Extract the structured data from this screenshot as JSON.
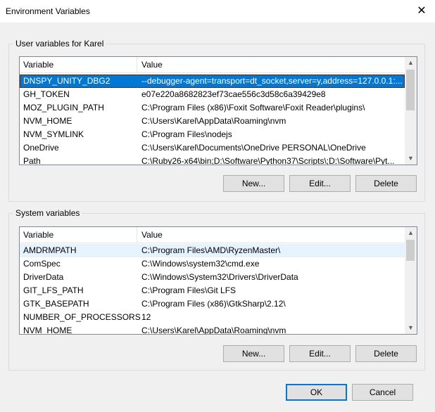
{
  "window": {
    "title": "Environment Variables",
    "close_glyph": "✕"
  },
  "user_section": {
    "label": "User variables for Karel",
    "columns": [
      "Variable",
      "Value"
    ],
    "rows": [
      {
        "variable": "DNSPY_UNITY_DBG2",
        "value": "--debugger-agent=transport=dt_socket,server=y,address=127.0.0.1:..."
      },
      {
        "variable": "GH_TOKEN",
        "value": "e07e220a8682823ef73cae556c3d58c6a39429e8"
      },
      {
        "variable": "MOZ_PLUGIN_PATH",
        "value": "C:\\Program Files (x86)\\Foxit Software\\Foxit Reader\\plugins\\"
      },
      {
        "variable": "NVM_HOME",
        "value": "C:\\Users\\Karel\\AppData\\Roaming\\nvm"
      },
      {
        "variable": "NVM_SYMLINK",
        "value": "C:\\Program Files\\nodejs"
      },
      {
        "variable": "OneDrive",
        "value": "C:\\Users\\Karel\\Documents\\OneDrive PERSONAL\\OneDrive"
      },
      {
        "variable": "Path",
        "value": "C:\\Ruby26-x64\\bin;D:\\Software\\Python37\\Scripts\\;D:\\Software\\Pyt..."
      }
    ],
    "buttons": {
      "new": "New...",
      "edit": "Edit...",
      "delete": "Delete"
    }
  },
  "system_section": {
    "label": "System variables",
    "columns": [
      "Variable",
      "Value"
    ],
    "rows": [
      {
        "variable": "AMDRMPATH",
        "value": "C:\\Program Files\\AMD\\RyzenMaster\\"
      },
      {
        "variable": "ComSpec",
        "value": "C:\\Windows\\system32\\cmd.exe"
      },
      {
        "variable": "DriverData",
        "value": "C:\\Windows\\System32\\Drivers\\DriverData"
      },
      {
        "variable": "GIT_LFS_PATH",
        "value": "C:\\Program Files\\Git LFS"
      },
      {
        "variable": "GTK_BASEPATH",
        "value": "C:\\Program Files (x86)\\GtkSharp\\2.12\\"
      },
      {
        "variable": "NUMBER_OF_PROCESSORS",
        "value": "12"
      },
      {
        "variable": "NVM_HOME",
        "value": "C:\\Users\\Karel\\AppData\\Roaming\\nvm"
      }
    ],
    "buttons": {
      "new": "New...",
      "edit": "Edit...",
      "delete": "Delete"
    }
  },
  "footer": {
    "ok": "OK",
    "cancel": "Cancel"
  },
  "colors": {
    "selection": "#0078d7",
    "hover": "#e5f3ff",
    "default_border": "#0078d7"
  },
  "icons": {
    "close": "close-icon",
    "scroll_up": "chevron-up-icon",
    "scroll_down": "chevron-down-icon"
  }
}
